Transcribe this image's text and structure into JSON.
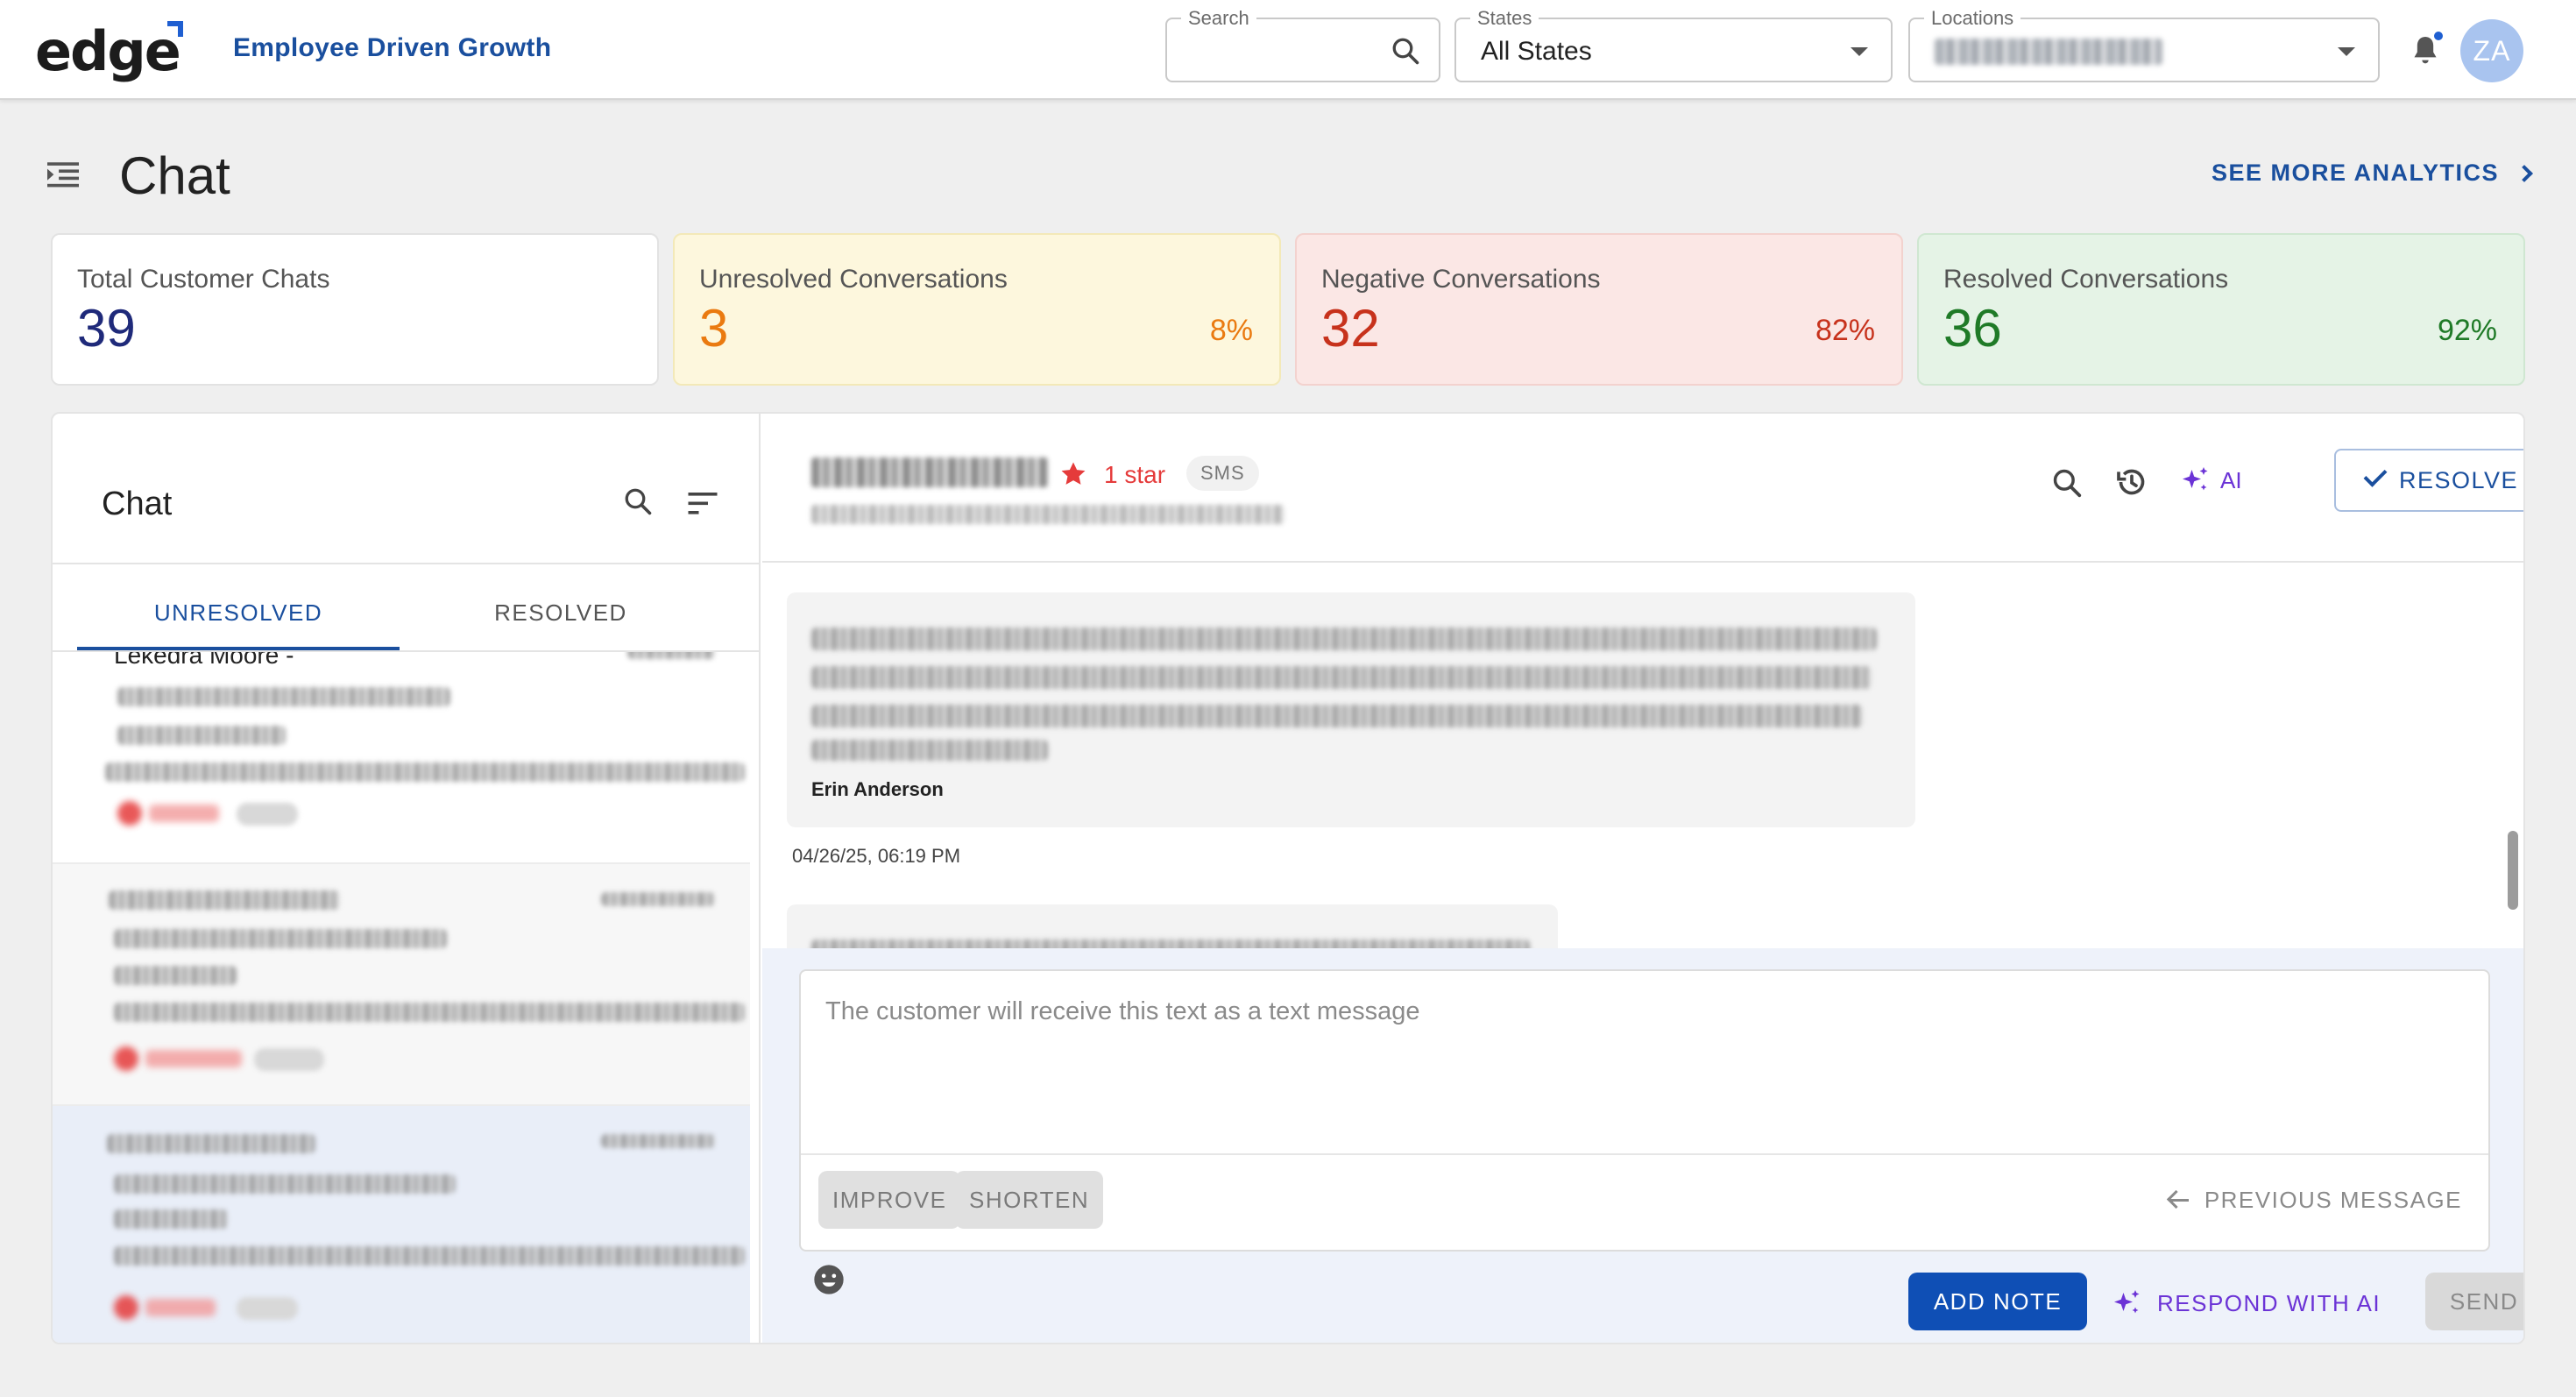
{
  "header": {
    "logo_text": "edge",
    "tagline": "Employee Driven Growth",
    "search": {
      "label": "Search",
      "value": ""
    },
    "states": {
      "label": "States",
      "value": "All States"
    },
    "locations": {
      "label": "Locations"
    },
    "avatar_initials": "ZA"
  },
  "page": {
    "title": "Chat",
    "see_more": "SEE MORE ANALYTICS"
  },
  "stats": {
    "total": {
      "label": "Total Customer Chats",
      "value": "39"
    },
    "unresolved": {
      "label": "Unresolved Conversations",
      "value": "3",
      "pct": "8%"
    },
    "negative": {
      "label": "Negative Conversations",
      "value": "32",
      "pct": "82%"
    },
    "resolved": {
      "label": "Resolved Conversations",
      "value": "36",
      "pct": "92%"
    }
  },
  "chat_list": {
    "title": "Chat",
    "tabs": [
      "UNRESOLVED",
      "RESOLVED"
    ],
    "active_tab": "UNRESOLVED",
    "first_item_name": "Lekedra Moore -"
  },
  "conversation": {
    "rating": "1 star",
    "channel": "SMS",
    "ai_label": "AI",
    "resolve_label": "RESOLVE",
    "message": {
      "author": "Erin Anderson",
      "timestamp": "04/26/25, 06:19 PM"
    }
  },
  "composer": {
    "placeholder": "The customer will receive this text as a text message",
    "improve": "IMPROVE",
    "shorten": "SHORTEN",
    "previous": "PREVIOUS MESSAGE",
    "add_note": "ADD NOTE",
    "respond_ai": "RESPOND WITH AI",
    "send": "SEND"
  },
  "colors": {
    "brand": "#1a4f9e",
    "primary_button": "#0f4fb5",
    "ai_accent": "#6b33d6",
    "unresolved": "#ea7a10",
    "negative": "#c7321c",
    "resolved": "#1f7a27",
    "rating_star": "#e53b3b"
  }
}
